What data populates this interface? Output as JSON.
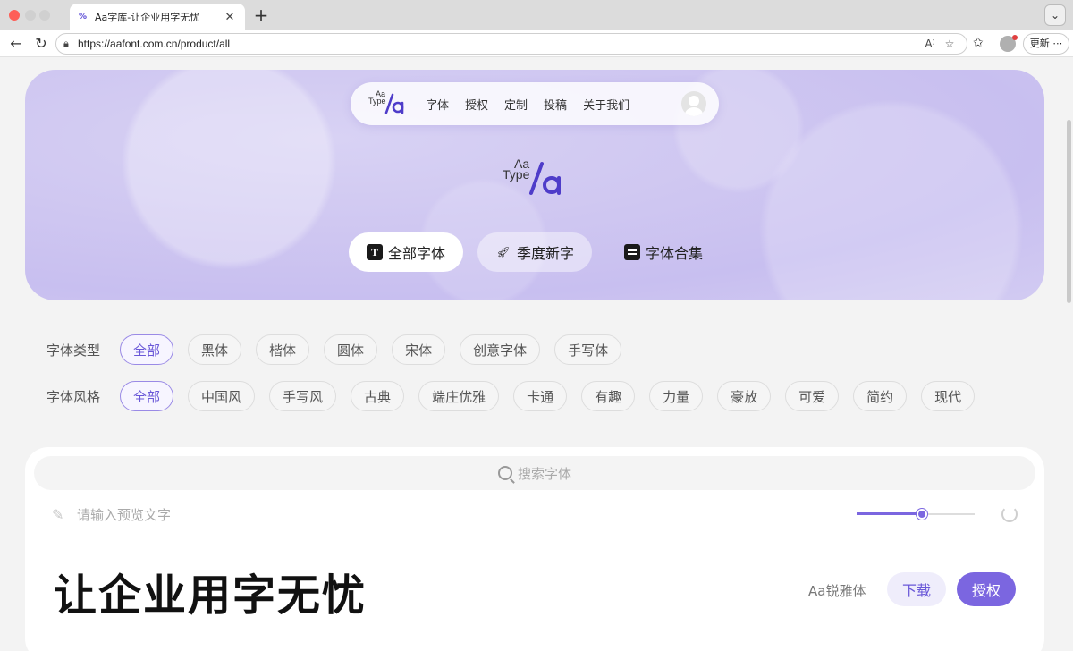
{
  "browser": {
    "tab_title": "Aa字库-让企业用字无忧",
    "url": "https://aafont.com.cn/product/all",
    "update_label": "更新"
  },
  "logo": {
    "line1": "Aa",
    "line2": "Type",
    "mark": "/a"
  },
  "hero_nav": {
    "links": [
      "字体",
      "授权",
      "定制",
      "投稿",
      "关于我们"
    ]
  },
  "category_tabs": [
    "全部字体",
    "季度新字",
    "字体合集"
  ],
  "filters": {
    "type": {
      "label": "字体类型",
      "chips": [
        "全部",
        "黑体",
        "楷体",
        "圆体",
        "宋体",
        "创意字体",
        "手写体"
      ]
    },
    "style": {
      "label": "字体风格",
      "chips": [
        "全部",
        "中国风",
        "手写风",
        "古典",
        "端庄优雅",
        "卡通",
        "有趣",
        "力量",
        "豪放",
        "可爱",
        "简约",
        "现代"
      ]
    }
  },
  "search": {
    "placeholder": "搜索字体"
  },
  "preview": {
    "placeholder": "请输入预览文字",
    "size_fraction": 0.55
  },
  "font_card": {
    "sample": "让企业用字无忧",
    "name": "Aa锐雅体",
    "download_label": "下载",
    "license_label": "授权"
  },
  "colors": {
    "accent": "#7b66e0",
    "hero": "#cfc7f1"
  }
}
